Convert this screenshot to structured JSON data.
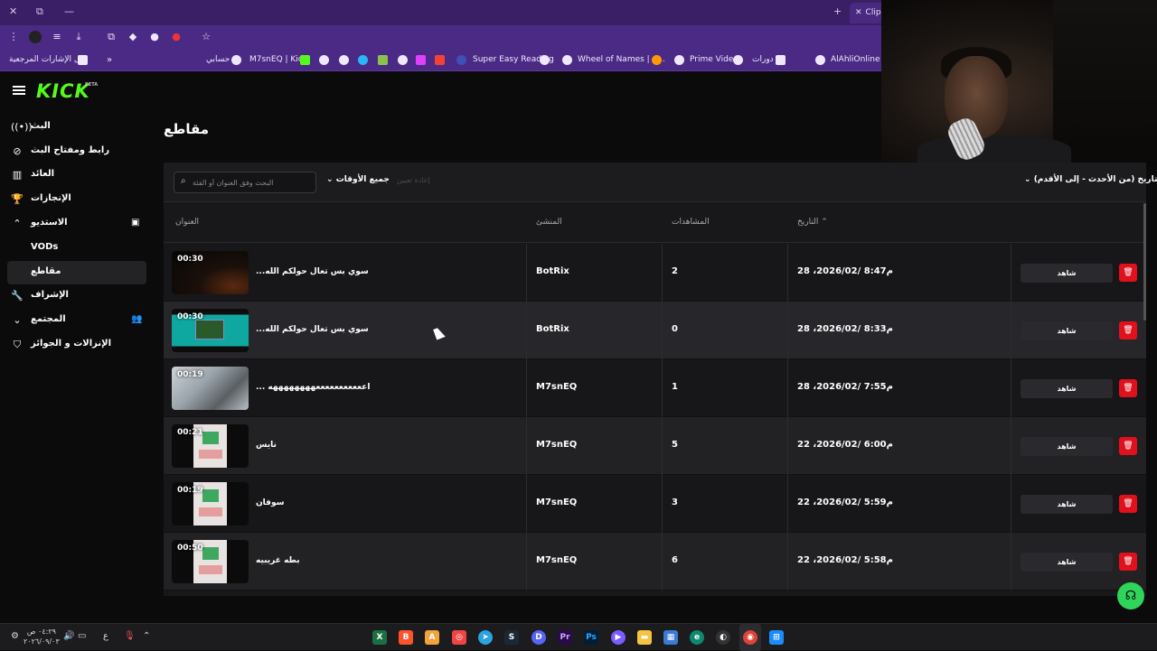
{
  "browser": {
    "window_controls": [
      "✕",
      "⧉",
      "—"
    ],
    "new_tab": "+",
    "tab_close": "✕",
    "tab_title": "Clip",
    "bookmarks": [
      {
        "label": "كل الإشارات المرجعية",
        "icon": "folder-icon"
      },
      {
        "label": "حسابي",
        "icon": "globe-icon"
      },
      {
        "label": "M7snEQ | Kick",
        "icon": "kick-icon"
      },
      {
        "label": "Super Easy Reading",
        "icon": "globe-icon"
      },
      {
        "label": "Wheel of Names | م...",
        "icon": "globe-icon"
      },
      {
        "label": "Prime Video",
        "icon": "globe-icon"
      },
      {
        "label": "دورات",
        "icon": "folder-icon"
      },
      {
        "label": "AlAhliOnline",
        "icon": "globe-icon"
      }
    ],
    "chevron": "»"
  },
  "sidebar": {
    "logo": "KICK",
    "logo_badge": "BETA",
    "items": [
      {
        "label": "البث",
        "icon": "broadcast-icon"
      },
      {
        "label": "رابط ومفتاح البث",
        "icon": "link-icon"
      },
      {
        "label": "العائد",
        "icon": "revenue-icon"
      },
      {
        "label": "الإنجازات",
        "icon": "trophy-icon"
      },
      {
        "label": "الاستديو",
        "icon": "chevron-up-icon"
      },
      {
        "label": "VODs"
      },
      {
        "label": "مقاطع"
      },
      {
        "label": "الإشراف",
        "icon": "wrench-icon"
      },
      {
        "label": "المجتمع",
        "icon": "chevron-down-icon"
      },
      {
        "label": "الإنزالات و الجوائز",
        "icon": "drops-icon"
      }
    ]
  },
  "main": {
    "title": "مقاطع",
    "search_placeholder": "البحث وفق العنوان أو الفئة",
    "time_filter": "جميع الأوقات",
    "clear_button": "إعادة تعيين",
    "sort_select": "التاريخ (من الأحدث - إلى الأقدم)",
    "columns": {
      "title": "العنوان",
      "creator": "المنشئ",
      "views": "المشاهدات",
      "date": "التاريخ"
    },
    "watch_label": "شاهد",
    "clips": [
      {
        "duration": "00:30",
        "title": "...سوي بس تعال حولكم الله",
        "creator": "BotRix",
        "views": "2",
        "date": "28 ،2026/02/ 8:47م"
      },
      {
        "duration": "00:30",
        "title": "...سوي بس تعال حولكم الله",
        "creator": "BotRix",
        "views": "0",
        "date": "28 ،2026/02/ 8:33م"
      },
      {
        "duration": "00:19",
        "title": "... اعععععععععععههههههههه",
        "creator": "M7snEQ",
        "views": "1",
        "date": "28 ،2026/02/ 7:55م"
      },
      {
        "duration": "00:21",
        "title": "نايس",
        "creator": "M7snEQ",
        "views": "5",
        "date": "22 ،2026/02/ 6:00م"
      },
      {
        "duration": "00:19",
        "title": "سوفان",
        "creator": "M7snEQ",
        "views": "3",
        "date": "22 ،2026/02/ 5:59م"
      },
      {
        "duration": "00:50",
        "title": "بطه غريبيه",
        "creator": "M7snEQ",
        "views": "6",
        "date": "22 ،2026/02/ 5:58م"
      }
    ]
  },
  "taskbar": {
    "clock_time": "٠٤:٢٩ ص",
    "clock_date": "٢٠٢٦/٠٩/٠٣",
    "lang": "ع",
    "apps": [
      "excel-icon",
      "brave-icon",
      "app-icon",
      "app2-icon",
      "telegram-icon",
      "steam-icon",
      "discord-icon",
      "premiere-icon",
      "photoshop-icon",
      "app3-icon",
      "explorer-icon",
      "store-icon",
      "edge-icon",
      "obs-icon",
      "chrome-icon",
      "start-icon"
    ],
    "app_labels": {
      "premiere": "Pr",
      "photoshop": "Ps"
    }
  },
  "colors": {
    "accent": "#53fc18",
    "delete": "#e0101c",
    "purple_chrome": "#4b2a86"
  }
}
